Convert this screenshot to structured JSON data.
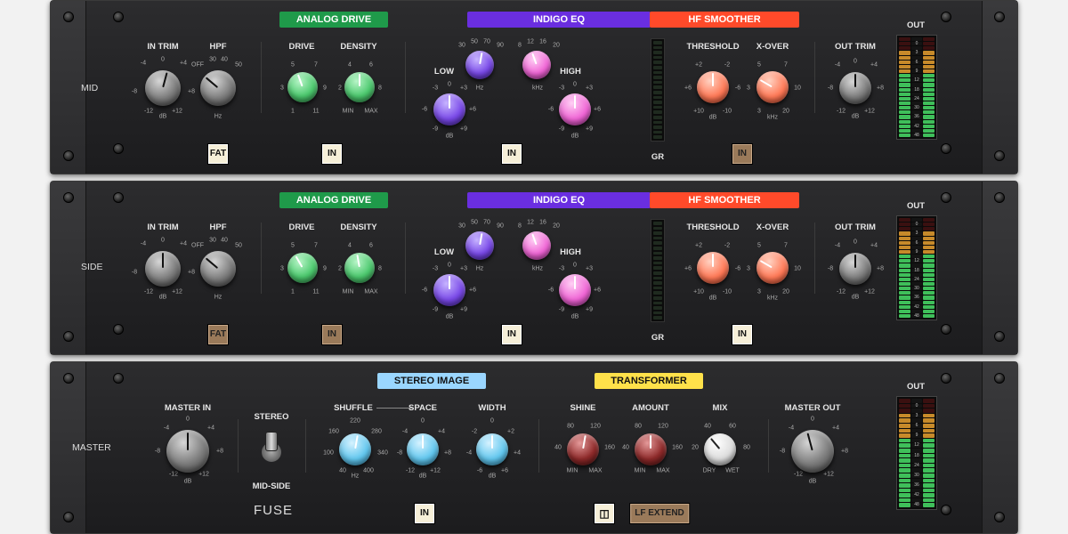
{
  "racks": [
    {
      "row_label": "MID",
      "in_trim": {
        "label": "IN TRIM",
        "scale": [
          "-4",
          "0",
          "+4",
          "-8",
          "+8",
          "-12",
          "+12",
          "dB"
        ]
      },
      "hpf": {
        "label": "HPF",
        "scale": [
          "30",
          "40",
          "OFF",
          "50",
          "Hz"
        ]
      },
      "analog_drive": {
        "header": "ANALOG DRIVE",
        "drive_label": "DRIVE",
        "density_label": "DENSITY",
        "drive_scale": [
          "5",
          "7",
          "3",
          "9",
          "1",
          "11"
        ],
        "density_scale": [
          "4",
          "6",
          "2",
          "8",
          "MIN",
          "MAX"
        ]
      },
      "indigo_eq": {
        "header": "INDIGO EQ",
        "low_label": "LOW",
        "high_label": "HIGH",
        "lo_freq_scale": [
          "30",
          "50",
          "70",
          "90",
          "Hz"
        ],
        "hi_freq_scale": [
          "8",
          "12",
          "16",
          "20",
          "kHz"
        ],
        "low_gain_scale": [
          "-3",
          "0",
          "+3",
          "-6",
          "+6",
          "-9",
          "+9",
          "dB"
        ],
        "high_gain_scale": [
          "-3",
          "0",
          "+3",
          "-6",
          "+6",
          "-9",
          "+9",
          "dB"
        ]
      },
      "hf_smoother": {
        "header": "HF SMOOTHER",
        "threshold_label": "THRESHOLD",
        "xover_label": "X-OVER",
        "threshold_scale": [
          "+2",
          "-2",
          "+6",
          "-6",
          "+10",
          "-10",
          "dB"
        ],
        "xover_scale": [
          "5",
          "7",
          "3",
          "10",
          "3",
          "20",
          "kHz"
        ]
      },
      "out_trim": {
        "label": "OUT TRIM",
        "scale": [
          "-4",
          "0",
          "+4",
          "-8",
          "+8",
          "-12",
          "+12",
          "dB"
        ]
      },
      "gr_label": "GR",
      "out_label": "OUT",
      "buttons": {
        "fat": "FAT",
        "drive_in": "IN",
        "eq_in": "IN",
        "hf_in": "IN"
      }
    },
    {
      "row_label": "SIDE",
      "in_trim": {
        "label": "IN TRIM",
        "scale": [
          "-4",
          "0",
          "+4",
          "-8",
          "+8",
          "-12",
          "+12",
          "dB"
        ]
      },
      "hpf": {
        "label": "HPF",
        "scale": [
          "30",
          "40",
          "OFF",
          "50",
          "Hz"
        ]
      },
      "analog_drive": {
        "header": "ANALOG DRIVE",
        "drive_label": "DRIVE",
        "density_label": "DENSITY",
        "drive_scale": [
          "5",
          "7",
          "3",
          "9",
          "1",
          "11"
        ],
        "density_scale": [
          "4",
          "6",
          "2",
          "8",
          "MIN",
          "MAX"
        ]
      },
      "indigo_eq": {
        "header": "INDIGO EQ",
        "low_label": "LOW",
        "high_label": "HIGH",
        "lo_freq_scale": [
          "30",
          "50",
          "70",
          "90",
          "Hz"
        ],
        "hi_freq_scale": [
          "8",
          "12",
          "16",
          "20",
          "kHz"
        ],
        "low_gain_scale": [
          "-3",
          "0",
          "+3",
          "-6",
          "+6",
          "-9",
          "+9",
          "dB"
        ],
        "high_gain_scale": [
          "-3",
          "0",
          "+3",
          "-6",
          "+6",
          "-9",
          "+9",
          "dB"
        ]
      },
      "hf_smoother": {
        "header": "HF SMOOTHER",
        "threshold_label": "THRESHOLD",
        "xover_label": "X-OVER",
        "threshold_scale": [
          "+2",
          "-2",
          "+6",
          "-6",
          "+10",
          "-10",
          "dB"
        ],
        "xover_scale": [
          "5",
          "7",
          "3",
          "10",
          "3",
          "20",
          "kHz"
        ]
      },
      "out_trim": {
        "label": "OUT TRIM",
        "scale": [
          "-4",
          "0",
          "+4",
          "-8",
          "+8",
          "-12",
          "+12",
          "dB"
        ]
      },
      "gr_label": "GR",
      "out_label": "OUT",
      "buttons": {
        "fat": "FAT",
        "drive_in": "IN",
        "eq_in": "IN",
        "hf_in": "IN"
      }
    }
  ],
  "master": {
    "row_label": "MASTER",
    "master_in": {
      "label": "MASTER IN",
      "scale": [
        "0",
        "-4",
        "+4",
        "-8",
        "+8",
        "-12",
        "+12",
        "dB"
      ]
    },
    "stereo": {
      "top_label": "STEREO",
      "bottom_label": "MID-SIDE"
    },
    "stereo_image": {
      "header": "STEREO IMAGE",
      "shuffle_label": "SHUFFLE",
      "space_label": "SPACE",
      "width_label": "WIDTH",
      "shuffle_scale": [
        "220",
        "160",
        "280",
        "100",
        "340",
        "40",
        "400",
        "Hz"
      ],
      "space_scale": [
        "0",
        "-4",
        "+4",
        "-8",
        "+8",
        "-12",
        "+12",
        "dB"
      ],
      "width_scale": [
        "0",
        "-2",
        "+2",
        "-4",
        "+4",
        "-6",
        "+6",
        "dB"
      ]
    },
    "transformer": {
      "header": "TRANSFORMER",
      "shine_label": "SHINE",
      "amount_label": "AMOUNT",
      "mix_label": "MIX",
      "shine_scale": [
        "80",
        "120",
        "40",
        "160",
        "MIN",
        "MAX"
      ],
      "amount_scale": [
        "80",
        "120",
        "40",
        "160",
        "MIN",
        "MAX"
      ],
      "mix_scale": [
        "40",
        "60",
        "20",
        "80",
        "DRY",
        "WET"
      ]
    },
    "master_out": {
      "label": "MASTER OUT",
      "scale": [
        "0",
        "-4",
        "+4",
        "-8",
        "+8",
        "-12",
        "+12",
        "dB"
      ]
    },
    "out_label": "OUT",
    "brand": "FUSE",
    "buttons": {
      "image_in": "IN",
      "lf_extend": "LF EXTEND"
    }
  },
  "meter_scale": [
    "0",
    "3",
    "6",
    "9",
    "12",
    "18",
    "24",
    "30",
    "36",
    "42",
    "48"
  ],
  "colors": {
    "analog_drive": "#1f9a4a",
    "indigo_eq": "#6a2ee0",
    "hf_smoother": "#ff4a2a",
    "stereo_image": "#9ad6ff",
    "transformer": "#ffe14a"
  }
}
